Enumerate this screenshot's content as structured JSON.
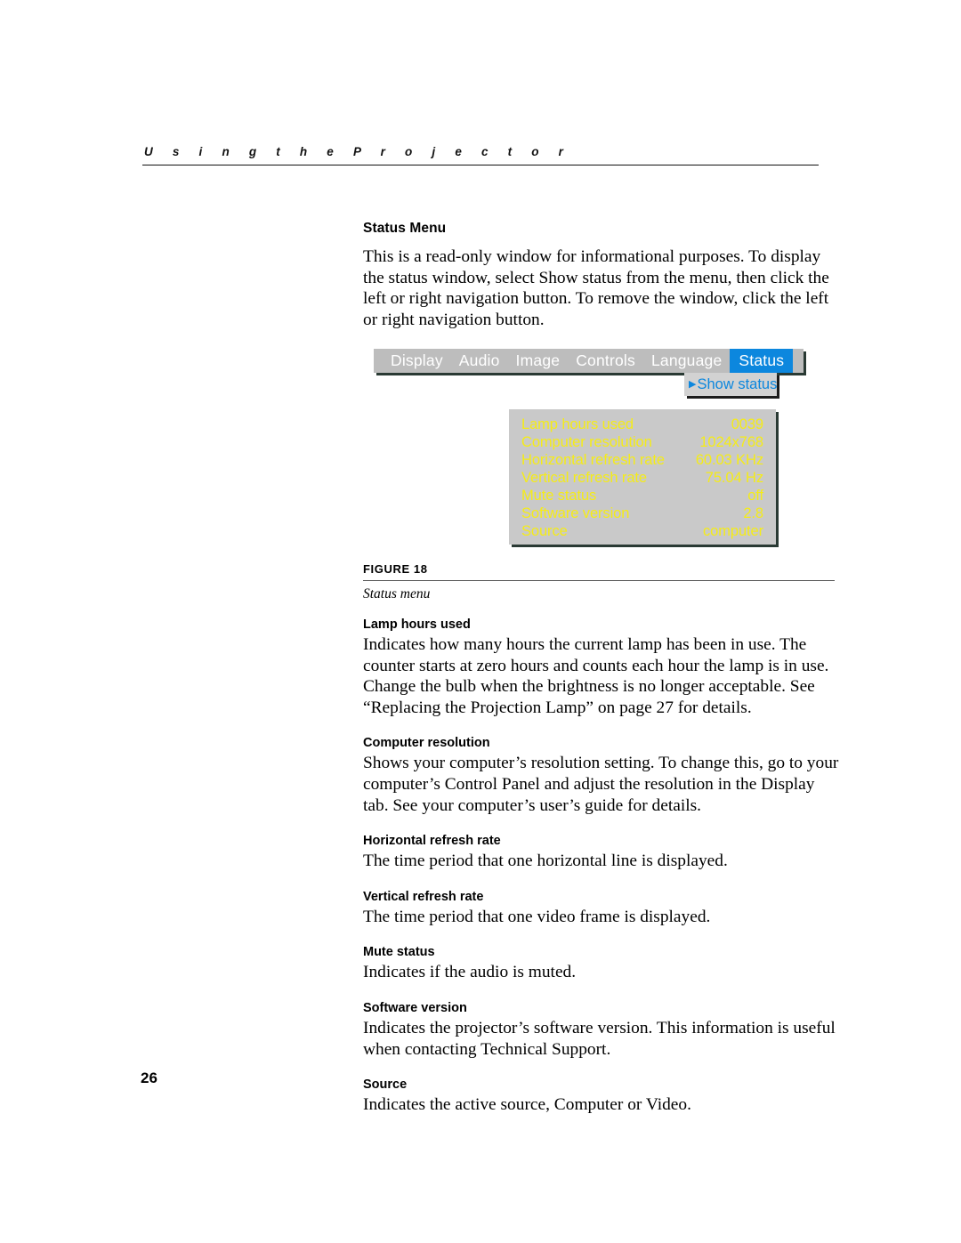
{
  "page": {
    "running_head": "U s i n g   t h e   P r o j e c t o r",
    "folio": "26"
  },
  "section": {
    "title": "Status Menu",
    "intro": "This is a read-only window for informational purposes. To display the status window, select Show status from the menu, then click the left or right navigation button. To remove the window, click the left or right navigation button."
  },
  "figure": {
    "number": "FIGURE 18",
    "caption": "Status menu",
    "menu_bar": {
      "items": [
        {
          "label": "Display",
          "active": false
        },
        {
          "label": "Audio",
          "active": false
        },
        {
          "label": "Image",
          "active": false
        },
        {
          "label": "Controls",
          "active": false
        },
        {
          "label": "Language",
          "active": false
        },
        {
          "label": "Status",
          "active": true
        }
      ],
      "background_color": "#bdbdbd",
      "text_color": "#ffffff",
      "active_color": "#0c87de"
    },
    "dropdown": {
      "arrow": "▶",
      "label": "Show status",
      "background_color": "#d2d2d2",
      "text_color": "#0c87de"
    },
    "status_panel": {
      "background_color": "#c9c9c9",
      "text_color": "#f5ec18",
      "rows": [
        {
          "label": "Lamp hours used",
          "value": "0039"
        },
        {
          "label": "Computer resolution",
          "value": "1024x768"
        },
        {
          "label": "Horizontal refresh rate",
          "value": "60.03 KHz"
        },
        {
          "label": "Vertical refresh rate",
          "value": "75.04 Hz"
        },
        {
          "label": "Mute status",
          "value": "off"
        },
        {
          "label": "Software version",
          "value": "2.8"
        },
        {
          "label": "Source",
          "value": "computer"
        }
      ]
    }
  },
  "glossary": [
    {
      "term": "Lamp hours used",
      "description": "Indicates how many hours the current lamp has been in use. The counter starts at zero hours and counts each hour the lamp is in use. Change the bulb when the brightness is no longer acceptable. See “Replacing the Projection Lamp” on page 27 for details."
    },
    {
      "term": "Computer resolution",
      "description": "Shows your computer’s resolution setting. To change this, go to your computer’s Control Panel and adjust the resolution in the Display tab. See your computer’s user’s guide for details."
    },
    {
      "term": "Horizontal refresh rate",
      "description": "The time period that one horizontal line is displayed."
    },
    {
      "term": "Vertical refresh rate",
      "description": "The time period that one video frame is displayed."
    },
    {
      "term": "Mute status",
      "description": "Indicates if the audio is muted."
    },
    {
      "term": "Software version",
      "description": "Indicates the projector’s software version. This information is useful when contacting Technical Support."
    },
    {
      "term": "Source",
      "description": "Indicates the active source, Computer or Video."
    }
  ]
}
